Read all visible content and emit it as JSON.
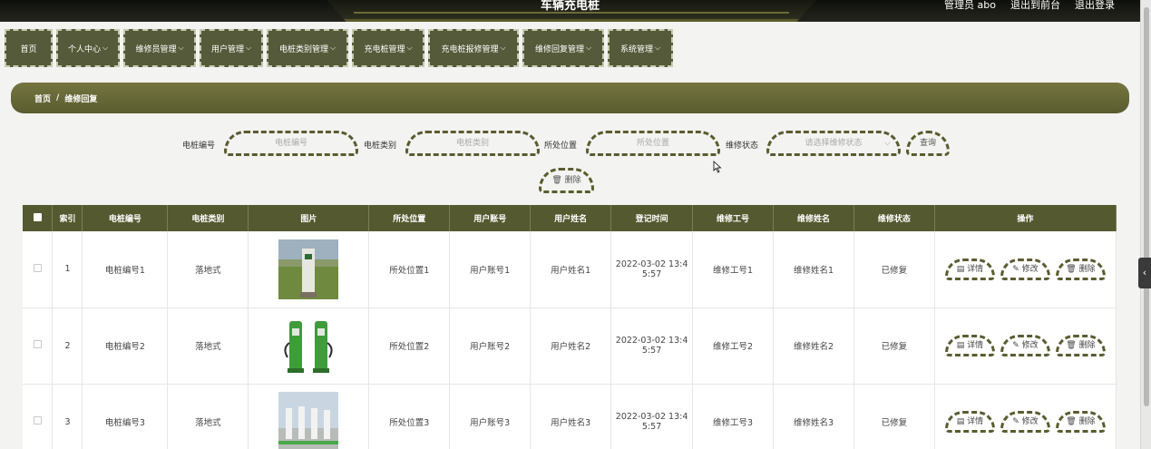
{
  "header": {
    "title": "车辆充电桩",
    "admin_label": "管理员 abo",
    "front_link": "退出到前台",
    "logout_link": "退出登录"
  },
  "nav": [
    {
      "label": "首页",
      "dropdown": false
    },
    {
      "label": "个人中心",
      "dropdown": true
    },
    {
      "label": "维修员管理",
      "dropdown": true
    },
    {
      "label": "用户管理",
      "dropdown": true
    },
    {
      "label": "电桩类别管理",
      "dropdown": true
    },
    {
      "label": "充电桩管理",
      "dropdown": true
    },
    {
      "label": "充电桩报修管理",
      "dropdown": true
    },
    {
      "label": "维修回复管理",
      "dropdown": true
    },
    {
      "label": "系统管理",
      "dropdown": true
    }
  ],
  "breadcrumb": {
    "home": "首页",
    "separator": "/",
    "current": "维修回复"
  },
  "filters": {
    "f1": {
      "label": "电桩编号",
      "placeholder": "电桩编号"
    },
    "f2": {
      "label": "电桩类别",
      "placeholder": "电桩类别"
    },
    "f3": {
      "label": "所处位置",
      "placeholder": "所处位置"
    },
    "f4": {
      "label": "维修状态",
      "placeholder": "请选择维修状态"
    },
    "search_btn": "查询",
    "delete_btn": "删除"
  },
  "table": {
    "headers": [
      "索引",
      "电桩编号",
      "电桩类别",
      "图片",
      "所处位置",
      "用户账号",
      "用户姓名",
      "登记时间",
      "维修工号",
      "维修姓名",
      "维修状态",
      "操作"
    ],
    "rows": [
      {
        "index": "1",
        "pile_no": "电桩编号1",
        "category": "落地式",
        "location": "所处位置1",
        "account": "用户账号1",
        "user_name": "用户姓名1",
        "time_a": "2022-03-02 13:4",
        "time_b": "5:57",
        "worker_no": "维修工号1",
        "worker_name": "维修姓名1",
        "status": "已修复"
      },
      {
        "index": "2",
        "pile_no": "电桩编号2",
        "category": "落地式",
        "location": "所处位置2",
        "account": "用户账号2",
        "user_name": "用户姓名2",
        "time_a": "2022-03-02 13:4",
        "time_b": "5:57",
        "worker_no": "维修工号2",
        "worker_name": "维修姓名2",
        "status": "已修复"
      },
      {
        "index": "3",
        "pile_no": "电桩编号3",
        "category": "落地式",
        "location": "所处位置3",
        "account": "用户账号3",
        "user_name": "用户姓名3",
        "time_a": "2022-03-02 13:4",
        "time_b": "5:57",
        "worker_no": "维修工号3",
        "worker_name": "维修姓名3",
        "status": "已修复"
      }
    ],
    "ops": {
      "detail": "详情",
      "edit": "修改",
      "delete": "删除"
    }
  },
  "colors": {
    "theme": "#55592f",
    "header": "#1a1b15"
  }
}
